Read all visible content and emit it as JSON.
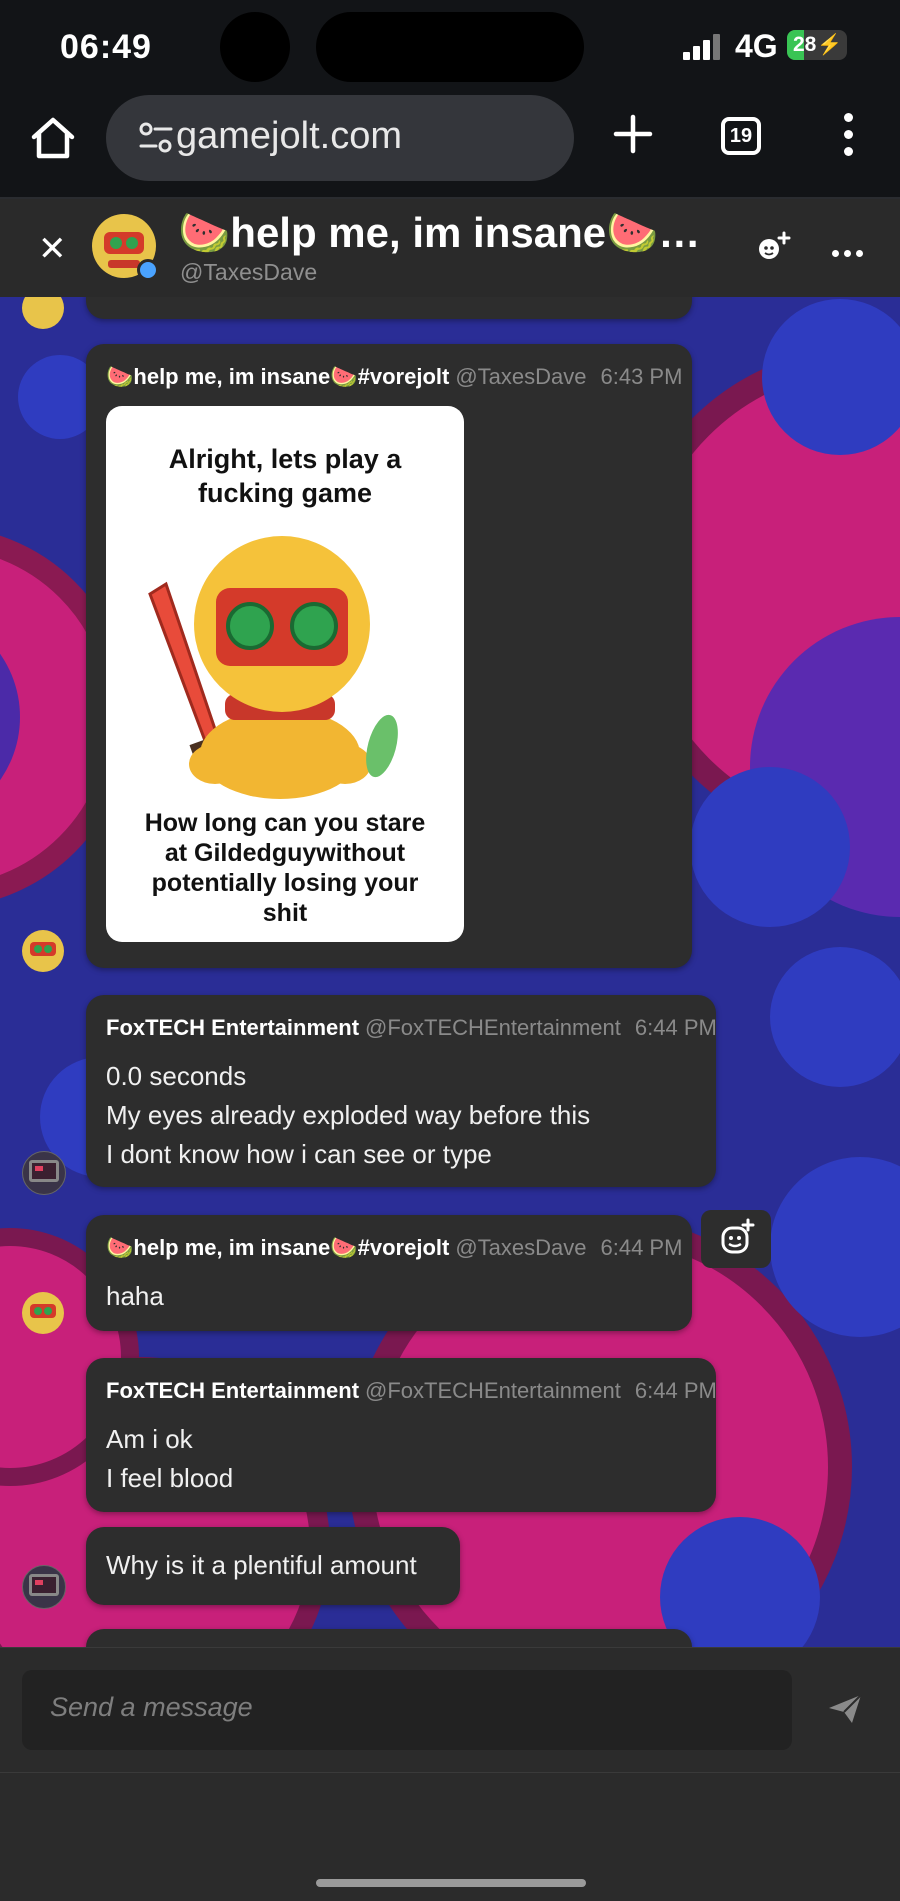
{
  "status_bar": {
    "time": "06:49",
    "network": "4G",
    "battery": "28",
    "battery_level": 0.28,
    "charging_icon": "bolt-icon"
  },
  "browser": {
    "url": "gamejolt.com",
    "tab_count": "19"
  },
  "chat_header": {
    "title": "🍉help me, im insane🍉#...",
    "handle": "@TaxesDave"
  },
  "messages": [
    {
      "name": "🍉help me, im insane🍉#vorejolt",
      "handle": "@TaxesDave",
      "time": "6:43 PM",
      "image": {
        "top_text_1": "Alright, lets play a",
        "top_text_2": "fucking game",
        "bottom_text_1": "How long can you stare",
        "bottom_text_2": "at Gildedguywithout",
        "bottom_text_3": "potentially losing your",
        "bottom_text_4": "shit"
      }
    },
    {
      "name": "FoxTECH Entertainment",
      "handle": "@FoxTECHEntertainment",
      "time": "6:44 PM",
      "lines": [
        "0.0 seconds",
        "My eyes already exploded way before this",
        "I dont know how i can see or type"
      ]
    },
    {
      "name": "🍉help me, im insane🍉#vorejolt",
      "handle": "@TaxesDave",
      "time": "6:44 PM",
      "lines": [
        "haha"
      ]
    },
    {
      "name": "FoxTECH Entertainment",
      "handle": "@FoxTECHEntertainment",
      "time": "6:44 PM",
      "lines": [
        "Am i ok",
        "I feel blood"
      ]
    },
    {
      "lines": [
        "Why is it a plentiful amount"
      ]
    }
  ],
  "composer": {
    "placeholder": "Send a message"
  },
  "colors": {
    "chat_bg": "#2a2d96",
    "bubble": "#2d2d2d",
    "battery": "#39c454"
  }
}
